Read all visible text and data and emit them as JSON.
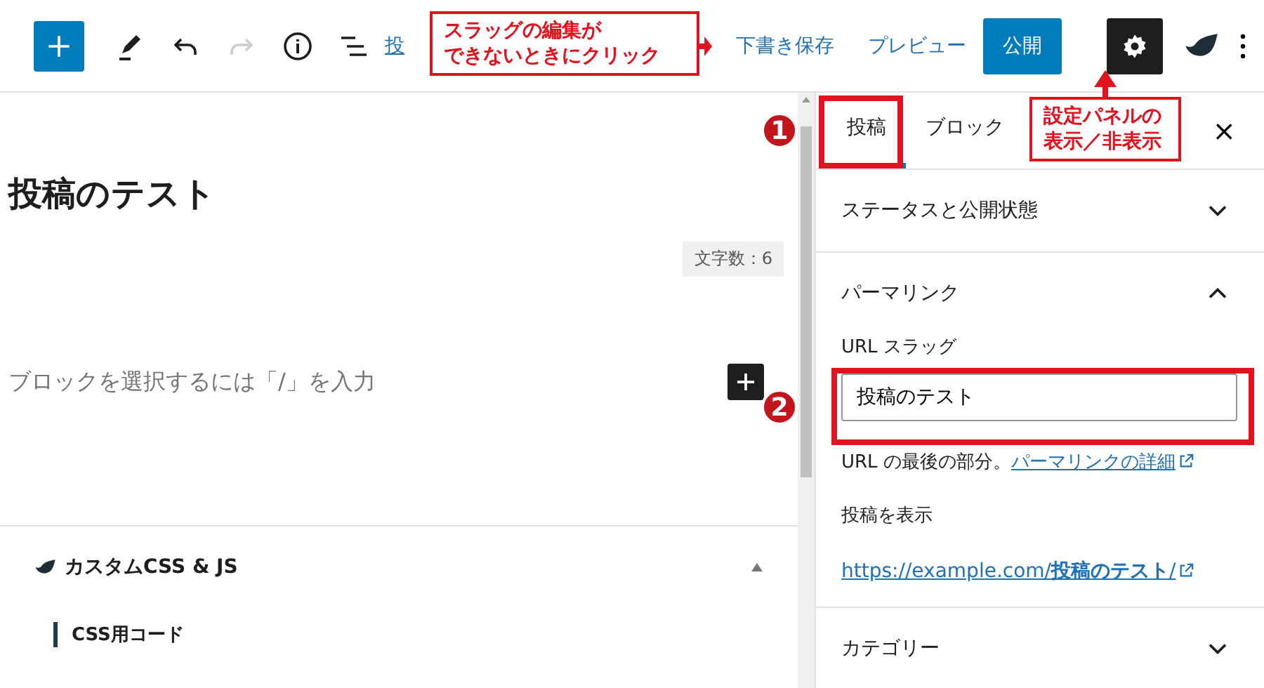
{
  "toolbar": {
    "link_text": "投",
    "save_draft": "下書き保存",
    "preview": "プレビュー",
    "publish": "公開",
    "settings_active": true
  },
  "editor": {
    "title": "投稿のテスト",
    "word_count": "文字数：6",
    "placeholder": "ブロックを選択するには「/」を入力"
  },
  "meta_box": {
    "title": "カスタムCSS & JS",
    "expanded": true,
    "field_label": "CSS用コード"
  },
  "sidebar": {
    "close": "×",
    "tabs": [
      {
        "label": "投稿",
        "selected": true
      },
      {
        "label": "ブロック",
        "selected": false
      }
    ],
    "panels": [
      {
        "title": "ステータスと公開状態",
        "expanded": false
      },
      {
        "title": "パーマリンク",
        "expanded": true
      },
      {
        "title": "カテゴリー",
        "expanded": false
      }
    ],
    "permalink": {
      "slug_label": "URL スラッグ",
      "slug_value": "投稿のテスト",
      "help_text": "URL の最後の部分。",
      "help_link": "パーマリンクの詳細",
      "view_label": "投稿を表示",
      "url": "https://example.com/**投稿のテスト**/"
    }
  },
  "annotations": {
    "callouts": [
      {
        "lines": [
          "スラッグの編集が",
          "できないときにクリック"
        ]
      },
      {
        "lines": [
          "設定パネルの",
          "表示／非表示"
        ]
      }
    ],
    "badges": [
      "1",
      "2"
    ]
  }
}
